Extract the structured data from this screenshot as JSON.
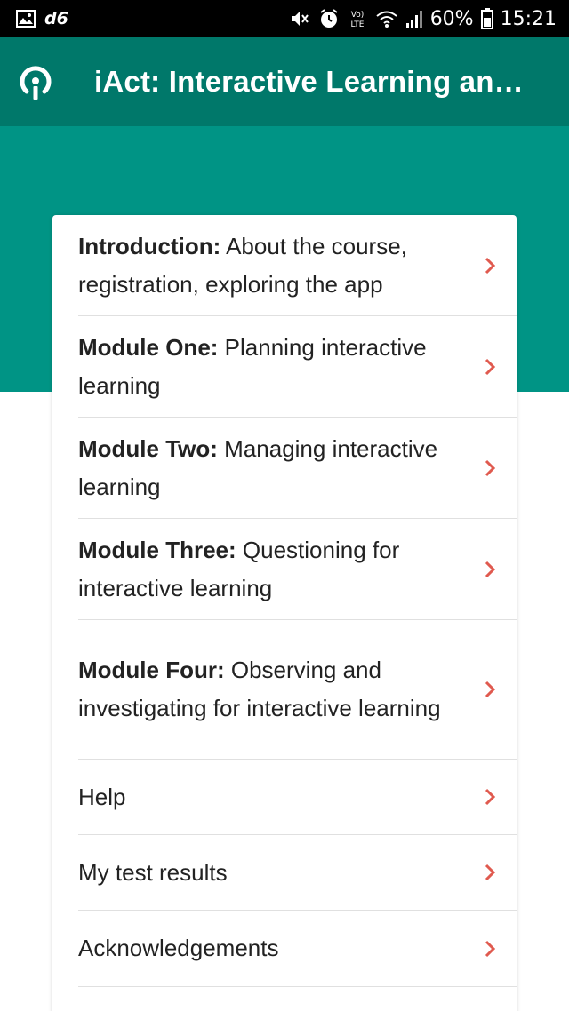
{
  "status_bar": {
    "carrier": "d6",
    "network_label": "Vo) LTE",
    "battery_percent": "60%",
    "time": "15:21"
  },
  "app_bar": {
    "title": "iAct: Interactive Learning and …"
  },
  "menu": {
    "items": [
      {
        "title": "Introduction:",
        "subtitle": " About the course, registration, exploring the app"
      },
      {
        "title": "Module One:",
        "subtitle": " Planning interactive learning"
      },
      {
        "title": "Module Two:",
        "subtitle": " Managing interactive learning"
      },
      {
        "title": "Module Three:",
        "subtitle": " Questioning for interactive learning"
      },
      {
        "title": "Module Four:",
        "subtitle": " Observing and investigating for interactive learning"
      },
      {
        "title": "",
        "subtitle": "Help"
      },
      {
        "title": "",
        "subtitle": "My test results"
      },
      {
        "title": "",
        "subtitle": "Acknowledgements"
      }
    ]
  },
  "colors": {
    "app_bar": "#00786a",
    "hero_band": "#009485",
    "chevron": "#e05a4f"
  }
}
